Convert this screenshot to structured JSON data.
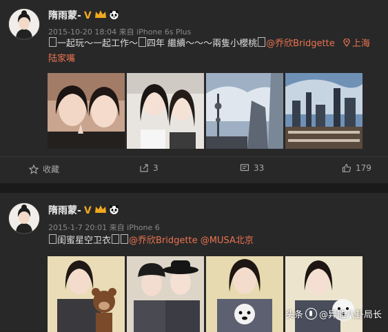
{
  "posts": [
    {
      "author": "隋雨蒙-",
      "verified_badge": "V",
      "timestamp": "2015-10-20 18:04",
      "source": "来自 iPhone 6s Plus",
      "text_a": "一起玩～一起工作～",
      "text_b": "四年 繼續～～～兩隻小櫻桃",
      "mention": "@乔欣Bridgette",
      "location_a": "上海",
      "location_b": "陆家嘴",
      "actions": {
        "favorite": "收藏",
        "repost": "3",
        "comment": "33",
        "like": "179"
      }
    },
    {
      "author": "隋雨蒙-",
      "verified_badge": "V",
      "timestamp": "2015-1-7 20:01",
      "source": "来自 iPhone 6",
      "text_a": "闺蜜星空卫衣",
      "mention_a": "@乔欣Bridgette",
      "mention_b": "@MUSA北京"
    }
  ],
  "watermark": {
    "prefix": "头条",
    "handle": "@异能八卦局长"
  },
  "colors": {
    "background": "#282828",
    "link": "#eb7350",
    "verified": "#f0a81e"
  }
}
